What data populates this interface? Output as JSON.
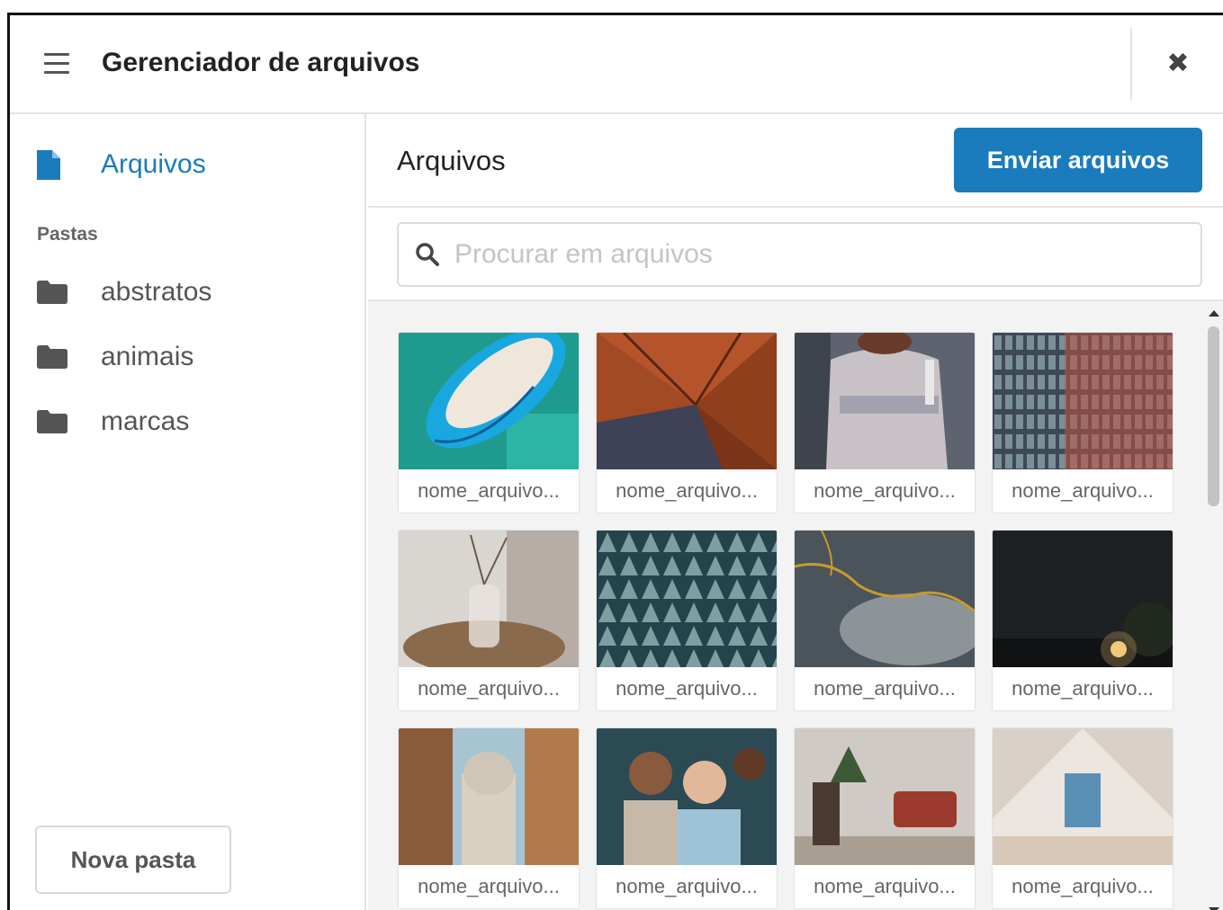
{
  "header": {
    "title": "Gerenciador de arquivos",
    "menu_icon": "hamburger-menu-icon",
    "close_icon": "close-icon",
    "close_glyph": "✖"
  },
  "sidebar": {
    "files_label": "Arquivos",
    "files_icon": "file-icon",
    "folders_heading": "Pastas",
    "folders": [
      {
        "label": "abstratos",
        "icon": "folder-icon"
      },
      {
        "label": "animais",
        "icon": "folder-icon"
      },
      {
        "label": "marcas",
        "icon": "folder-icon"
      }
    ],
    "new_folder_label": "Nova pasta"
  },
  "main": {
    "title": "Arquivos",
    "upload_label": "Enviar arquivos",
    "search": {
      "placeholder": "Procurar em arquivos",
      "value": "",
      "icon": "search-icon"
    },
    "files": [
      {
        "name": "nome_arquivo..."
      },
      {
        "name": "nome_arquivo..."
      },
      {
        "name": "nome_arquivo..."
      },
      {
        "name": "nome_arquivo..."
      },
      {
        "name": "nome_arquivo..."
      },
      {
        "name": "nome_arquivo..."
      },
      {
        "name": "nome_arquivo..."
      },
      {
        "name": "nome_arquivo..."
      },
      {
        "name": "nome_arquivo..."
      },
      {
        "name": "nome_arquivo..."
      },
      {
        "name": "nome_arquivo..."
      },
      {
        "name": "nome_arquivo..."
      }
    ]
  },
  "colors": {
    "accent": "#1a7bbd",
    "border": "#e3e3e3",
    "grid_background": "#f3f3f3"
  }
}
